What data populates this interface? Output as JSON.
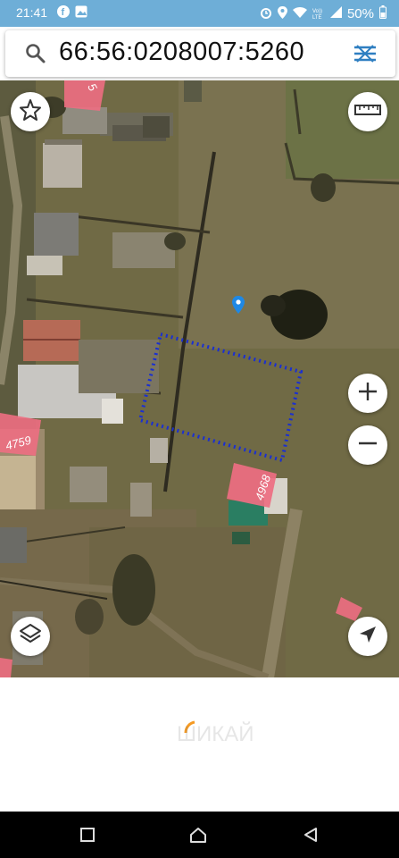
{
  "status_bar": {
    "time": "21:41",
    "battery": "50%",
    "icons": [
      "facebook-icon",
      "gallery-icon",
      "alarm-icon",
      "location-icon",
      "wifi-icon",
      "volte-icon",
      "signal-icon",
      "battery-icon"
    ]
  },
  "search": {
    "query": "66:56:0208007:5260",
    "icon": "search-icon",
    "right_icon": "map-layers-toggle-icon"
  },
  "map": {
    "parcel_labels": [
      "5",
      "4759",
      "4968"
    ],
    "selected_parcel_border_color": "#1a2fd1",
    "parcel_fill_color": "#ee6e82",
    "marker_color": "#1e88e5",
    "controls": [
      "favorite-star",
      "ruler",
      "zoom-in",
      "zoom-out",
      "layers",
      "my-location"
    ]
  },
  "watermark": "ШИКАЙ"
}
